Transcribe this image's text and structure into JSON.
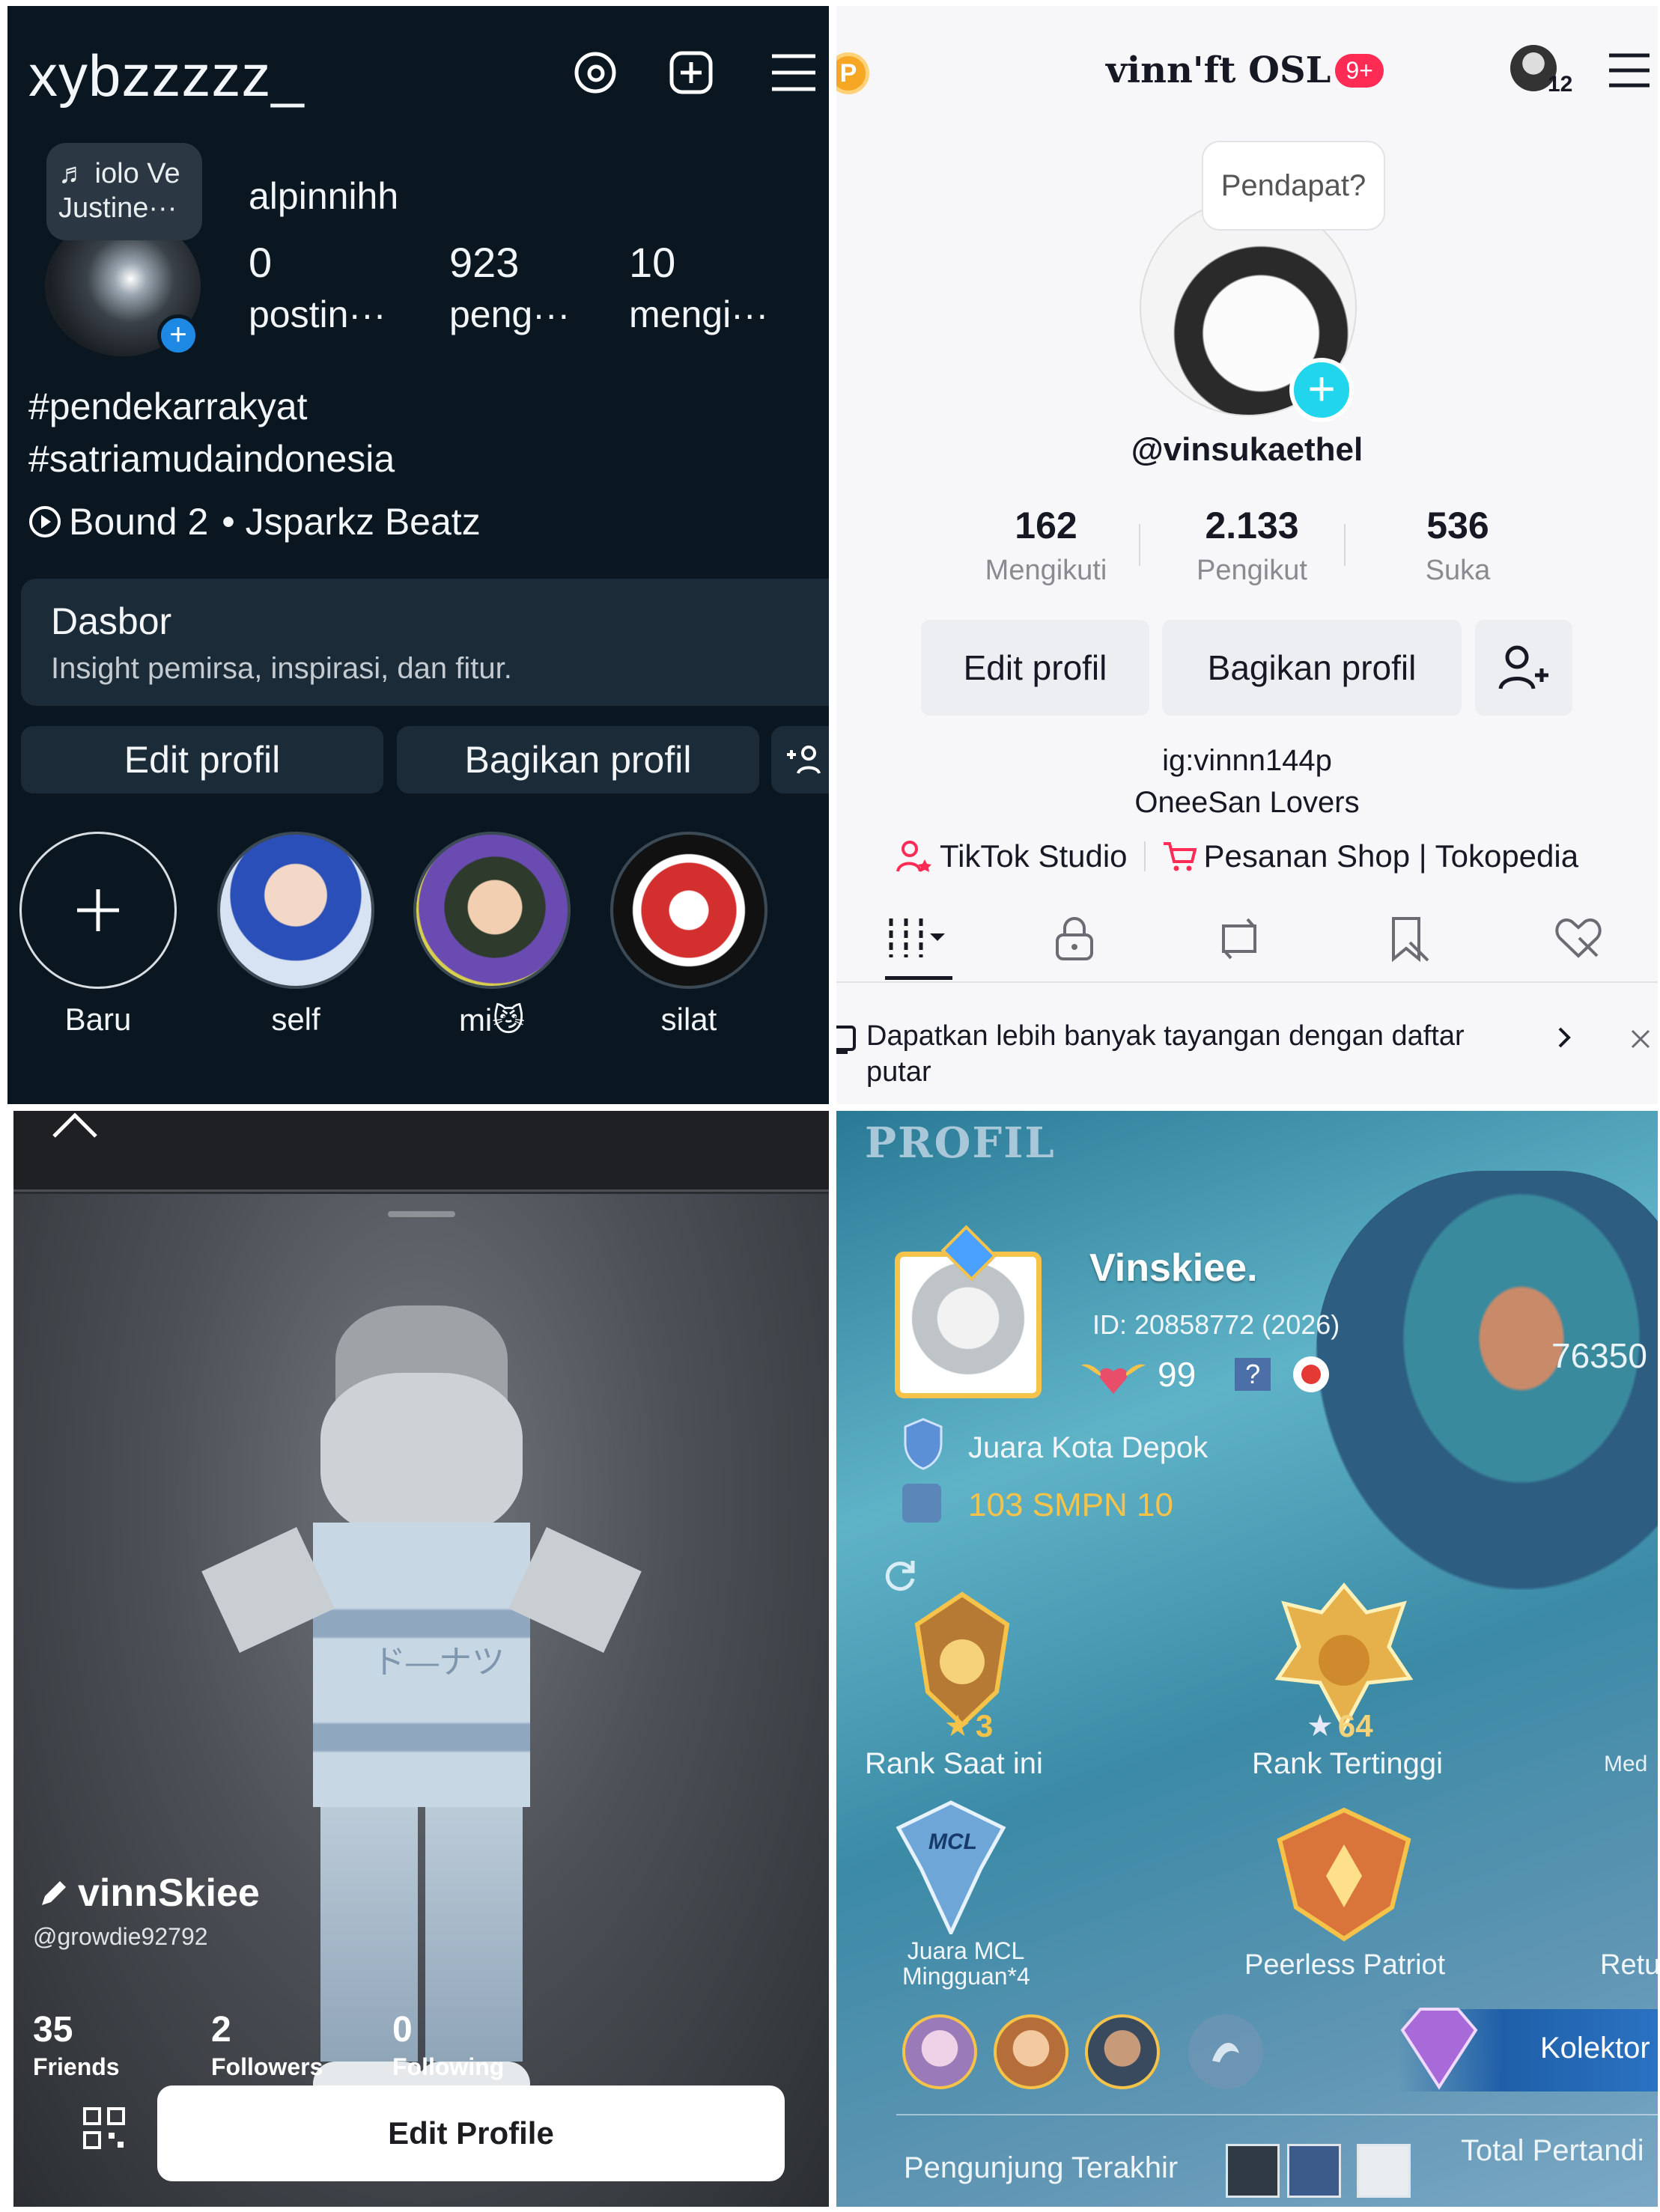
{
  "instagram": {
    "username": "xybzzzzz_",
    "note_bubble": "♬ iolo Ve Justine···",
    "display_name": "alpinnihh",
    "stats": [
      {
        "value": "0",
        "label": "postin···"
      },
      {
        "value": "923",
        "label": "peng···"
      },
      {
        "value": "10",
        "label": "mengi···"
      }
    ],
    "bio": [
      "#pendekarrakyat",
      "#satriamudaindonesia"
    ],
    "music_title": "Bound 2",
    "music_artist": "• Jsparkz Beatz",
    "dashboard_title": "Dasbor",
    "dashboard_sub": "Insight pemirsa, inspirasi, dan fitur.",
    "edit_button": "Edit profil",
    "share_button": "Bagikan profil",
    "highlights": [
      {
        "label": "Baru"
      },
      {
        "label": "self"
      },
      {
        "label": "mi😼"
      },
      {
        "label": "silat"
      }
    ]
  },
  "tiktok": {
    "coin_badge": "P",
    "title": "vinn'ft OSL",
    "notif_badge": "9+",
    "avatar_count": "12",
    "opinion_bubble": "Pendapat?",
    "handle": "@vinsukaethel",
    "stats": [
      {
        "value": "162",
        "label": "Mengikuti"
      },
      {
        "value": "2.133",
        "label": "Pengikut"
      },
      {
        "value": "536",
        "label": "Suka"
      }
    ],
    "edit_button": "Edit profil",
    "share_button": "Bagikan profil",
    "bio": [
      "ig:vinnn144p",
      "OneeSan Lovers"
    ],
    "links": [
      {
        "label": "TikTok Studio"
      },
      {
        "label": "Pesanan Shop | Tokopedia"
      }
    ],
    "banner_text": "Dapatkan lebih banyak tayangan dengan daftar putar"
  },
  "roblox": {
    "display_name": "vinnSkiee",
    "username": "@growdie92792",
    "stats": [
      {
        "value": "35",
        "label": "Friends"
      },
      {
        "value": "2",
        "label": "Followers"
      },
      {
        "value": "0",
        "label": "Following"
      }
    ],
    "edit_button": "Edit Profile",
    "shirt_text": "ド—ナツ"
  },
  "mlbb": {
    "header": "PROFIL",
    "player_name": "Vinskiee.",
    "player_id": "ID: 20858772 (2026)",
    "level": "99",
    "help": "?",
    "side_number": "76350",
    "title1": "Juara Kota Depok",
    "title2": "103 SMPN 10",
    "rank_current_stars": "3",
    "rank_current_label": "Rank Saat ini",
    "rank_highest_stars": "64",
    "rank_highest_label": "Rank Tertinggi",
    "side_label_1": "Med",
    "badge_mcl_text": "MCL",
    "badge_mcl_label": "Juara MCL Mingguan*4",
    "badge_peerless_label": "Peerless Patriot",
    "side_label_2": "Retu",
    "collector_label": "Kolektor Ter",
    "visitors_label": "Pengunjung Terakhir",
    "total_label": "Total Pertandi"
  },
  "colors": {
    "ig_bg": "#0a1620",
    "tiktok_accent": "#fe2c55",
    "tiktok_plus": "#20d5ec",
    "mlbb_gold": "#f5c24a"
  }
}
